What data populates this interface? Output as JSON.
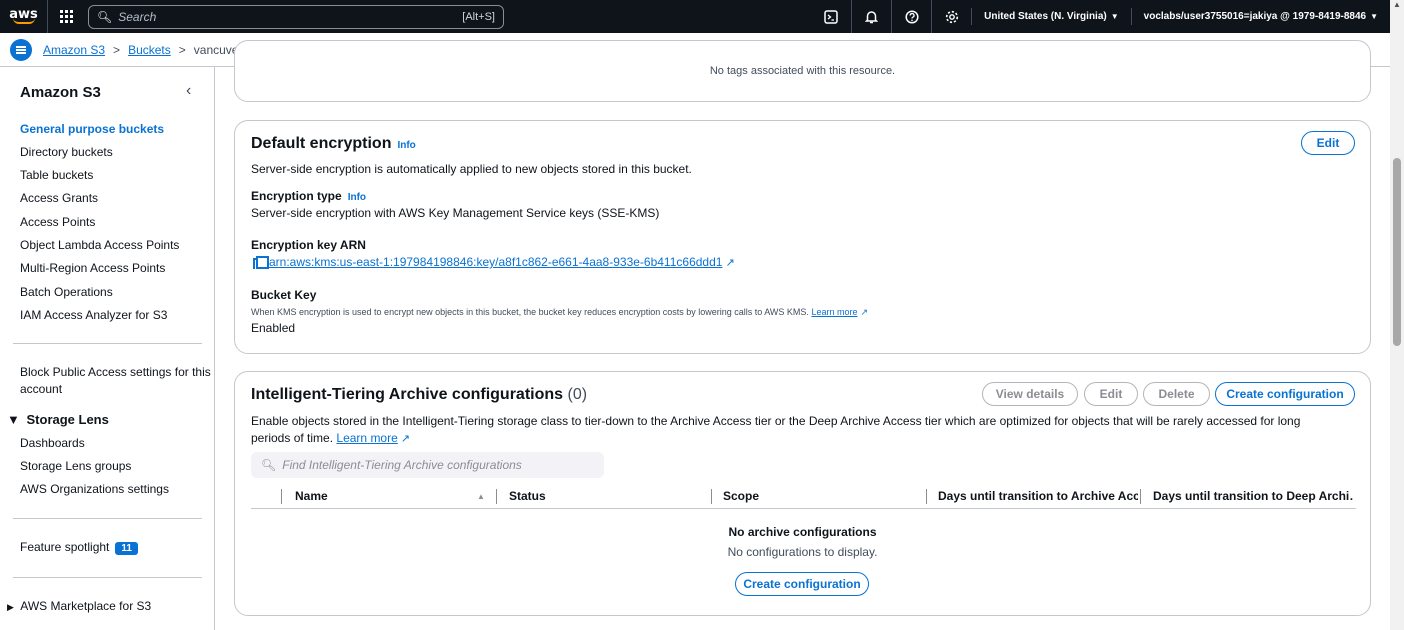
{
  "topnav": {
    "logo": "aws",
    "search_placeholder": "Search",
    "search_shortcut": "[Alt+S]",
    "region": "United States (N. Virginia)",
    "account": "voclabs/user3755016=jakiya @ 1979-8419-8846",
    "icons": [
      "cloudshell-icon",
      "bell-icon",
      "help-icon",
      "gear-icon"
    ]
  },
  "breadcrumb": {
    "items": [
      "Amazon S3",
      "Buckets"
    ],
    "current": "vancuverparks-trf-jak",
    "separator": ">"
  },
  "sidebar": {
    "title": "Amazon S3",
    "items": [
      "General purpose buckets",
      "Directory buckets",
      "Table buckets",
      "Access Grants",
      "Access Points",
      "Object Lambda Access Points",
      "Multi-Region Access Points",
      "Batch Operations",
      "IAM Access Analyzer for S3"
    ],
    "block_public_line1": "Block Public Access settings for this",
    "block_public_line2": "account",
    "storage_lens": {
      "title": "Storage Lens",
      "items": [
        "Dashboards",
        "Storage Lens groups",
        "AWS Organizations settings"
      ]
    },
    "feature_spotlight": "Feature spotlight",
    "feature_spotlight_count": "11",
    "marketplace": "AWS Marketplace for S3"
  },
  "tags_panel": {
    "empty_text": "No tags associated with this resource."
  },
  "encryption": {
    "title": "Default encryption",
    "info": "Info",
    "edit": "Edit",
    "description": "Server-side encryption is automatically applied to new objects stored in this bucket.",
    "type_label": "Encryption type",
    "type_info": "Info",
    "type_value": "Server-side encryption with AWS Key Management Service keys (SSE-KMS)",
    "arn_label": "Encryption key ARN",
    "arn_value": "arn:aws:kms:us-east-1:197984198846:key/a8f1c862-e661-4aa8-933e-6b411c66ddd1",
    "bucket_key_label": "Bucket Key",
    "bucket_key_desc": "When KMS encryption is used to encrypt new objects in this bucket, the bucket key reduces encryption costs by lowering calls to AWS KMS.",
    "learn_more": "Learn more",
    "bucket_key_value": "Enabled"
  },
  "tiering": {
    "title": "Intelligent-Tiering Archive configurations",
    "count": "(0)",
    "buttons": {
      "view_details": "View details",
      "edit": "Edit",
      "delete": "Delete",
      "create": "Create configuration"
    },
    "description": "Enable objects stored in the Intelligent-Tiering storage class to tier-down to the Archive Access tier or the Deep Archive Access tier which are optimized for objects that will be rarely accessed for long periods of time.",
    "learn": "Learn",
    "more": "more",
    "search_placeholder": "Find Intelligent-Tiering Archive configurations",
    "columns": [
      "Name",
      "Status",
      "Scope",
      "Days until transition to Archive Acc…",
      "Days until transition to Deep Archi…"
    ],
    "empty_title": "No archive configurations",
    "empty_sub": "No configurations to display.",
    "empty_button": "Create configuration"
  }
}
